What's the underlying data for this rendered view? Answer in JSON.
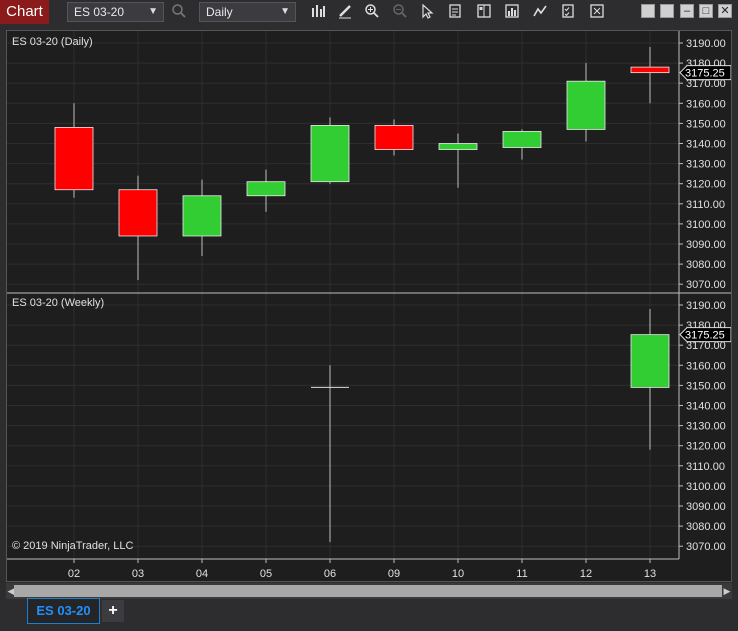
{
  "toolbar": {
    "chart_tab": "Chart",
    "instrument": "ES 03-20",
    "interval": "Daily",
    "icons": [
      "search-icon",
      "bar-type-icon",
      "draw-pencil-icon",
      "zoom-in-icon",
      "zoom-out-icon",
      "pointer-icon",
      "data-box-icon",
      "chart-trader-icon",
      "strategies-icon",
      "indicators-icon",
      "properties-icon",
      "share-icon"
    ],
    "window_buttons": [
      "restore-icon",
      "minimize-icon",
      "maximize-icon",
      "close-icon"
    ]
  },
  "panels": [
    {
      "label": "ES 03-20 (Daily)",
      "last_price": "3175.25"
    },
    {
      "label": "ES 03-20 (Weekly)",
      "last_price": "3175.25"
    }
  ],
  "copyright": "© 2019 NinjaTrader, LLC",
  "bottom_tabs": {
    "instrument_tab": "ES 03-20",
    "add_tab": "+"
  },
  "colors": {
    "up": "#32cd32",
    "down": "#ff0000",
    "background": "#1e1e1e",
    "price_marker_up": "#1e1e1e"
  },
  "chart_data": [
    {
      "type": "candlestick",
      "title": "ES 03-20 (Daily)",
      "categories": [
        "02",
        "03",
        "04",
        "05",
        "06",
        "09",
        "10",
        "11",
        "12",
        "13"
      ],
      "ohlc": [
        {
          "o": 3148,
          "h": 3160,
          "l": 3113,
          "c": 3117
        },
        {
          "o": 3117,
          "h": 3124,
          "l": 3072,
          "c": 3094
        },
        {
          "o": 3094,
          "h": 3122,
          "l": 3084,
          "c": 3114
        },
        {
          "o": 3114,
          "h": 3127,
          "l": 3106,
          "c": 3121
        },
        {
          "o": 3121,
          "h": 3153,
          "l": 3120,
          "c": 3149
        },
        {
          "o": 3149,
          "h": 3152,
          "l": 3134,
          "c": 3137
        },
        {
          "o": 3137,
          "h": 3145,
          "l": 3118,
          "c": 3140
        },
        {
          "o": 3138,
          "h": 3147,
          "l": 3132,
          "c": 3146
        },
        {
          "o": 3147,
          "h": 3180,
          "l": 3141,
          "c": 3171
        },
        {
          "o": 3178,
          "h": 3188,
          "l": 3160,
          "c": 3175.25
        }
      ],
      "y_ticks": [
        "3190.00",
        "3180.00",
        "3170.00",
        "3160.00",
        "3150.00",
        "3140.00",
        "3130.00",
        "3120.00",
        "3110.00",
        "3100.00",
        "3090.00",
        "3080.00",
        "3070.00"
      ],
      "ylim": [
        3065,
        3195
      ],
      "grid": true
    },
    {
      "type": "candlestick",
      "title": "ES 03-20 (Weekly)",
      "categories": [
        "02",
        "03",
        "04",
        "05",
        "06",
        "09",
        "10",
        "11",
        "12",
        "13"
      ],
      "ohlc": [
        {
          "o": null,
          "h": null,
          "l": null,
          "c": null
        },
        {
          "o": null,
          "h": null,
          "l": null,
          "c": null
        },
        {
          "o": null,
          "h": null,
          "l": null,
          "c": null
        },
        {
          "o": null,
          "h": null,
          "l": null,
          "c": null
        },
        {
          "o": 3149,
          "h": 3160,
          "l": 3072,
          "c": 3149
        },
        {
          "o": null,
          "h": null,
          "l": null,
          "c": null
        },
        {
          "o": null,
          "h": null,
          "l": null,
          "c": null
        },
        {
          "o": null,
          "h": null,
          "l": null,
          "c": null
        },
        {
          "o": null,
          "h": null,
          "l": null,
          "c": null
        },
        {
          "o": 3149,
          "h": 3188,
          "l": 3118,
          "c": 3175.25
        }
      ],
      "y_ticks": [
        "3190.00",
        "3180.00",
        "3170.00",
        "3160.00",
        "3150.00",
        "3140.00",
        "3130.00",
        "3120.00",
        "3110.00",
        "3100.00",
        "3090.00",
        "3080.00",
        "3070.00"
      ],
      "ylim": [
        3065,
        3195
      ],
      "grid": true
    }
  ]
}
